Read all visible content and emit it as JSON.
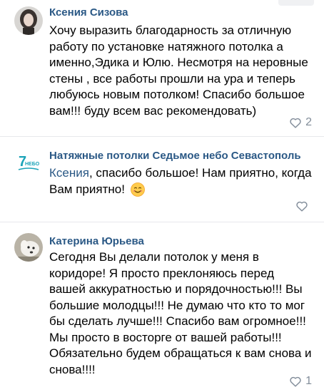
{
  "comments": [
    {
      "author": "Ксения Сизова",
      "text": "Хочу выразить благодарность  за отличную работу по установке натяжного потолка а именно,Эдика и Юлю. Несмотря на неровные стены , все работы прошли на ура и теперь любуюсь новым потолком! Спасибо большое вам!!! буду всем вас рекомендовать)",
      "likes": "2"
    },
    {
      "author": "Натяжные потолки Седьмое небо Севастополь",
      "avatar_text": "НЕБО",
      "reply_to": "Ксения",
      "text": ", спасибо большое! Нам приятно, когда Вам приятно!",
      "likes": ""
    },
    {
      "author": "Катерина Юрьева",
      "text": "Сегодня Вы делали потолок у меня в коридоре! Я просто преклоняюсь перед вашей аккуратностью и порядочностью!!! Вы большие молодцы!!! Не думаю что кто то мог бы сделать лучше!!! Спасибо вам огромное!!! Мы просто в восторге от вашей работы!!! Обязательно будем обращаться к вам снова и снова!!!!",
      "likes": "1"
    }
  ],
  "colors": {
    "author": "#2a5885",
    "muted": "#818c99",
    "divider": "#e7e8ec",
    "brand_teal": "#1ba3b8"
  },
  "icons": {
    "like": "heart-outline-icon",
    "emoji": "smiling-face-icon"
  }
}
